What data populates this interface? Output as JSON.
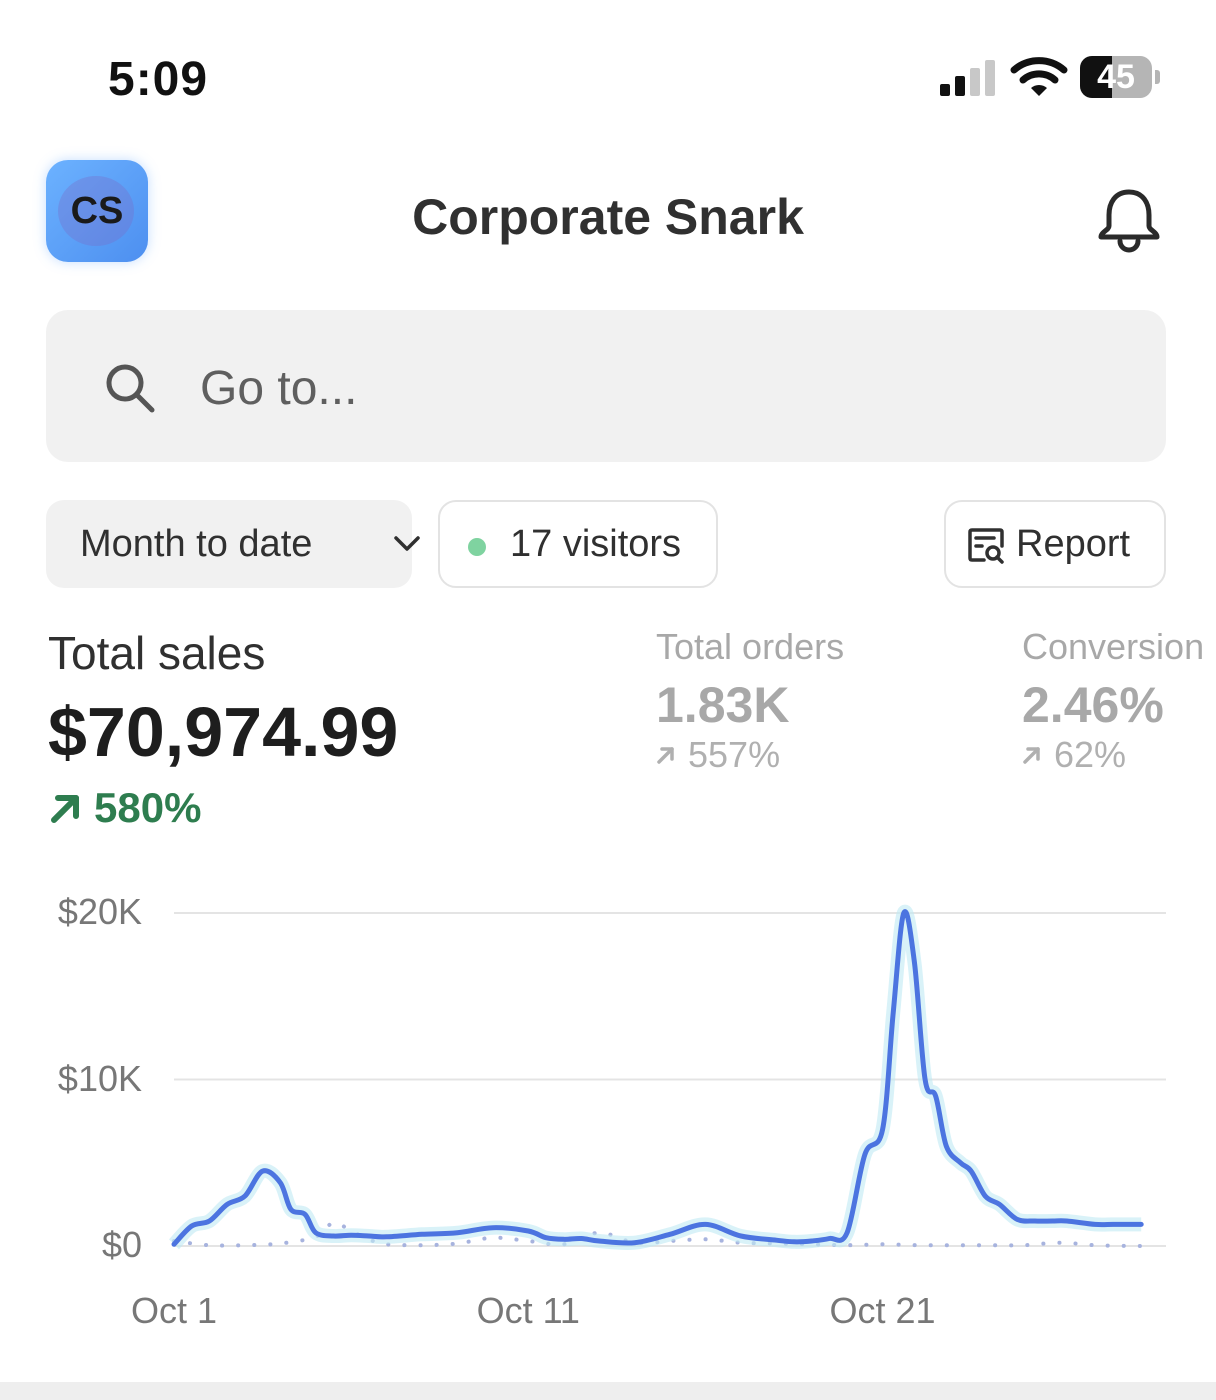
{
  "status_bar": {
    "time": "5:09",
    "battery": "45",
    "battery_level": 0.45,
    "signal_bars": 2,
    "icons": [
      "cellular-signal-icon",
      "wifi-icon",
      "battery-icon"
    ]
  },
  "header": {
    "logo_text": "CS",
    "title": "Corporate Snark",
    "icons": [
      "notification-bell-icon"
    ]
  },
  "search": {
    "placeholder": "Go to...",
    "icon": "search-icon"
  },
  "filters": {
    "date_range": "Month to date",
    "visitors": "17 visitors",
    "visitors_dot_color": "#7fd3a0",
    "report": "Report"
  },
  "metrics": {
    "total_sales": {
      "label": "Total sales",
      "value": "$70,974.99",
      "change": "580%"
    },
    "total_orders": {
      "label": "Total orders",
      "value": "1.83K",
      "change": "557%"
    },
    "conversion": {
      "label": "Conversion",
      "value": "2.46%",
      "change": "62%"
    },
    "colors": {
      "positive": "#2e7d4f",
      "accent": "#4c74e0"
    }
  },
  "chart_data": {
    "type": "line",
    "ylim": [
      0,
      20000
    ],
    "y_ticks": [
      "$0",
      "$10K",
      "$20K"
    ],
    "x_ticks": [
      {
        "label": "Oct 1",
        "day": 1
      },
      {
        "label": "Oct 11",
        "day": 11
      },
      {
        "label": "Oct 21",
        "day": 21
      }
    ],
    "series": [
      {
        "style": "solid",
        "color": "#4c74e0",
        "x": [
          1,
          1.5,
          2,
          2.5,
          3,
          3.5,
          4,
          4.3,
          4.7,
          5,
          5.5,
          6,
          6.5,
          7,
          8,
          9,
          10,
          11,
          11.5,
          12,
          12.5,
          13,
          14,
          15,
          16,
          17,
          18,
          18.5,
          19,
          19.5,
          20,
          20.5,
          21,
          21.3,
          21.6,
          21.9,
          22.2,
          22.5,
          22.8,
          23.2,
          23.5,
          23.9,
          24.3,
          24.8,
          25.3,
          25.8,
          26.2,
          27,
          27.5,
          28,
          28.3
        ],
        "y": [
          100,
          1200,
          1500,
          2500,
          3000,
          4500,
          3800,
          2200,
          1900,
          800,
          600,
          650,
          600,
          550,
          700,
          800,
          1100,
          900,
          500,
          400,
          450,
          300,
          200,
          700,
          1300,
          600,
          350,
          250,
          300,
          450,
          800,
          5500,
          7000,
          14000,
          20000,
          17000,
          10000,
          9000,
          6000,
          5000,
          4500,
          3000,
          2500,
          1600,
          1500,
          1500,
          1500,
          1300,
          1300,
          1300,
          1300
        ]
      },
      {
        "style": "dotted",
        "color": "#a7b3de",
        "x": [
          1,
          2,
          3,
          4,
          5,
          5.5,
          6,
          6.5,
          7,
          8,
          9,
          10,
          11,
          12,
          13,
          14,
          15,
          16,
          17,
          18,
          19,
          20,
          21,
          22,
          23,
          24,
          25,
          26,
          27,
          28,
          28.3
        ],
        "y": [
          300,
          50,
          50,
          150,
          550,
          1400,
          900,
          400,
          100,
          50,
          150,
          500,
          300,
          100,
          800,
          200,
          300,
          400,
          200,
          150,
          100,
          50,
          100,
          50,
          50,
          50,
          50,
          200,
          50,
          0,
          0
        ]
      }
    ]
  }
}
